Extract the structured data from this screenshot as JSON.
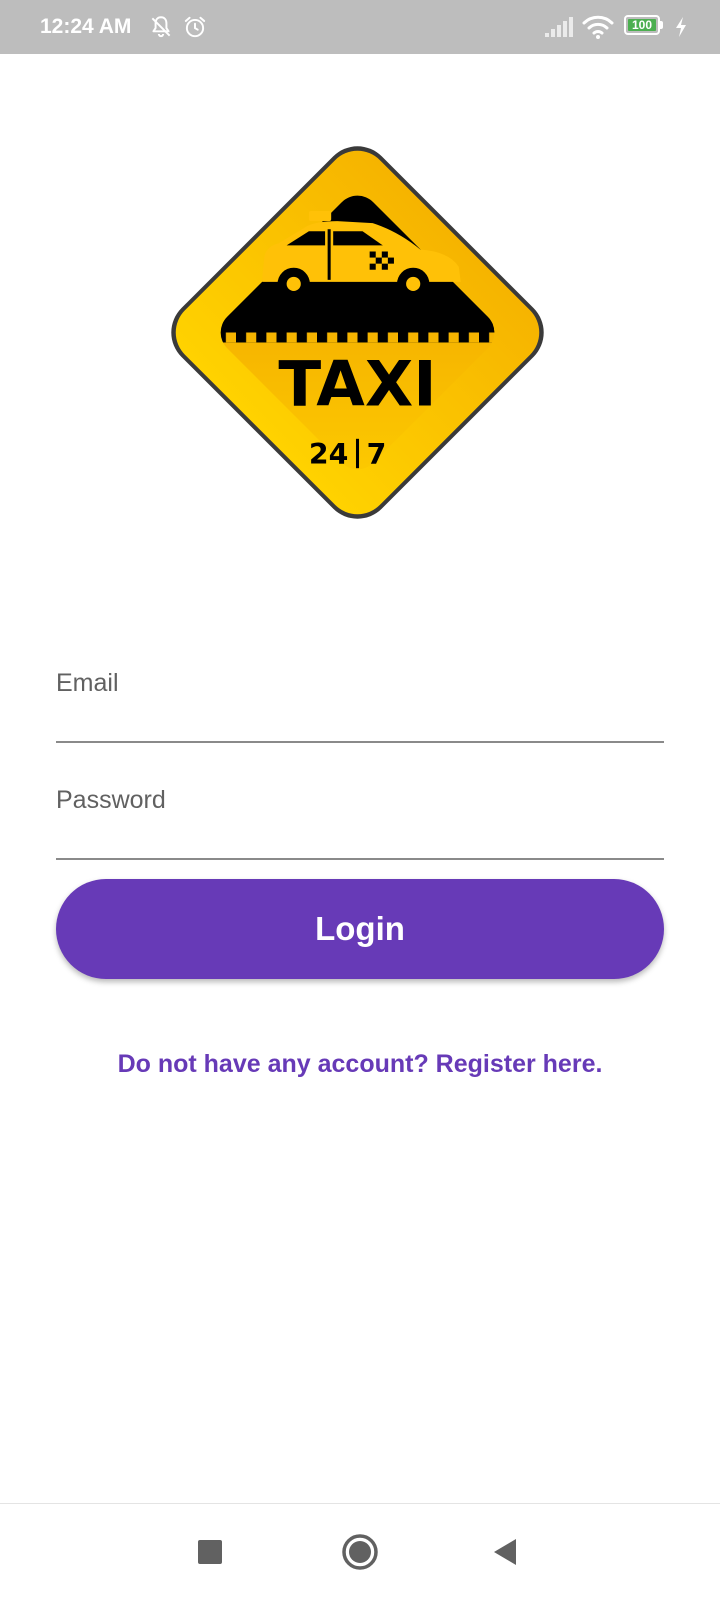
{
  "status_bar": {
    "time": "12:24 AM",
    "battery_level": "100",
    "icons": [
      "notifications-off-icon",
      "alarm-icon",
      "signal-icon",
      "wifi-icon",
      "battery-icon",
      "charging-icon"
    ]
  },
  "logo": {
    "title": "TAXI",
    "subtitle_left": "24",
    "subtitle_right": "7",
    "colors": {
      "yellow": "#FFC107",
      "black": "#000000"
    }
  },
  "form": {
    "email_label": "Email",
    "email_value": "",
    "password_label": "Password",
    "password_value": "",
    "login_label": "Login"
  },
  "register_link": "Do not have any account? Register here.",
  "nav_bar": {
    "icons": [
      "recents-square-icon",
      "home-circle-icon",
      "back-triangle-icon"
    ]
  },
  "colors": {
    "accent": "#673AB7",
    "status_bar": "#BDBDBD",
    "label": "#616161",
    "underline": "#8A8A8A",
    "battery": "#4CAF50"
  }
}
